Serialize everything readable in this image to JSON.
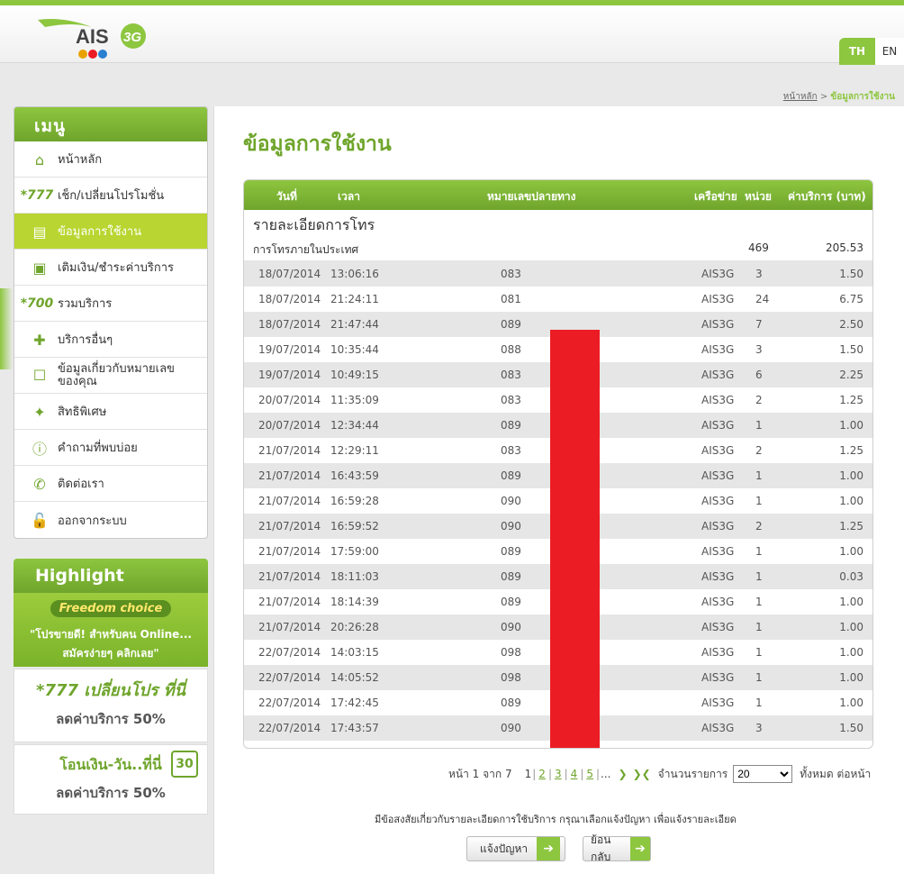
{
  "header": {
    "brand": "AIS",
    "brand_suffix": "3G",
    "lang_th": "TH",
    "lang_en": "EN"
  },
  "breadcrumb": {
    "home": "หน้าหลัก",
    "sep": ">",
    "current": "ข้อมูลการใช้งาน"
  },
  "sidebar": {
    "title": "เมนู",
    "items": [
      {
        "label": "หน้าหลัก",
        "icon": "home-icon",
        "glyph": "⌂"
      },
      {
        "label": "เช็ก/เปลี่ยนโปรโมชั่น",
        "icon": "star777-icon",
        "glyph": "*777"
      },
      {
        "label": "ข้อมูลการใช้งาน",
        "icon": "usage-icon",
        "glyph": "▤"
      },
      {
        "label": "เติมเงิน/ชำระค่าบริการ",
        "icon": "topup-icon",
        "glyph": "▣"
      },
      {
        "label": "รวมบริการ",
        "icon": "star700-icon",
        "glyph": "*700"
      },
      {
        "label": "บริการอื่นๆ",
        "icon": "mobile-plus-icon",
        "glyph": "✚"
      },
      {
        "label": "ข้อมูลเกี่ยวกับหมายเลขของคุณ",
        "icon": "profile-icon",
        "glyph": "☐"
      },
      {
        "label": "สิทธิพิเศษ",
        "icon": "gift-icon",
        "glyph": "✦"
      },
      {
        "label": "คำถามที่พบบ่อย",
        "icon": "info-icon",
        "glyph": "ⓘ"
      },
      {
        "label": "ติดต่อเรา",
        "icon": "phone-icon",
        "glyph": "✆"
      },
      {
        "label": "ออกจากระบบ",
        "icon": "lock-icon",
        "glyph": "🔓"
      }
    ]
  },
  "highlight": {
    "title": "Highlight",
    "banner1": {
      "brand": "Freedom choice",
      "line1": "\"โปรขายดี! สำหรับคน Online...",
      "line2": "สมัครง่ายๆ คลิกเลย\""
    },
    "banner2": {
      "line1": "*777 เปลี่ยนโปร ที่นี่",
      "line2": "ลดค่าบริการ 50%"
    },
    "banner3": {
      "line1": "โอนเงิน-วัน..ที่นี่",
      "line2": "ลดค่าบริการ 50%",
      "badge": "30"
    }
  },
  "main": {
    "title": "ข้อมูลการใช้งาน",
    "columns": {
      "date": "วันที่",
      "time": "เวลา",
      "number": "หมายเลขปลายทาง",
      "network": "เครือข่าย",
      "unit": "หน่วย",
      "charge": "ค่าบริการ (บาท)"
    },
    "section": "รายละเอียดการโทร",
    "subsection": {
      "label": "การโทรภายในประเทศ",
      "units": "469",
      "charge": "205.53"
    },
    "rows": [
      {
        "date": "18/07/2014",
        "time": "13:06:16",
        "number": "083",
        "network": "AIS3G",
        "unit": "3",
        "charge": "1.50"
      },
      {
        "date": "18/07/2014",
        "time": "21:24:11",
        "number": "081",
        "network": "AIS3G",
        "unit": "24",
        "charge": "6.75"
      },
      {
        "date": "18/07/2014",
        "time": "21:47:44",
        "number": "089",
        "network": "AIS3G",
        "unit": "7",
        "charge": "2.50"
      },
      {
        "date": "19/07/2014",
        "time": "10:35:44",
        "number": "088",
        "network": "AIS3G",
        "unit": "3",
        "charge": "1.50"
      },
      {
        "date": "19/07/2014",
        "time": "10:49:15",
        "number": "083",
        "network": "AIS3G",
        "unit": "6",
        "charge": "2.25"
      },
      {
        "date": "20/07/2014",
        "time": "11:35:09",
        "number": "083",
        "network": "AIS3G",
        "unit": "2",
        "charge": "1.25"
      },
      {
        "date": "20/07/2014",
        "time": "12:34:44",
        "number": "089",
        "network": "AIS3G",
        "unit": "1",
        "charge": "1.00"
      },
      {
        "date": "21/07/2014",
        "time": "12:29:11",
        "number": "083",
        "network": "AIS3G",
        "unit": "2",
        "charge": "1.25"
      },
      {
        "date": "21/07/2014",
        "time": "16:43:59",
        "number": "089",
        "network": "AIS3G",
        "unit": "1",
        "charge": "1.00"
      },
      {
        "date": "21/07/2014",
        "time": "16:59:28",
        "number": "090",
        "network": "AIS3G",
        "unit": "1",
        "charge": "1.00"
      },
      {
        "date": "21/07/2014",
        "time": "16:59:52",
        "number": "090",
        "network": "AIS3G",
        "unit": "2",
        "charge": "1.25"
      },
      {
        "date": "21/07/2014",
        "time": "17:59:00",
        "number": "089",
        "network": "AIS3G",
        "unit": "1",
        "charge": "1.00"
      },
      {
        "date": "21/07/2014",
        "time": "18:11:03",
        "number": "089",
        "network": "AIS3G",
        "unit": "1",
        "charge": "0.03"
      },
      {
        "date": "21/07/2014",
        "time": "18:14:39",
        "number": "089",
        "network": "AIS3G",
        "unit": "1",
        "charge": "1.00"
      },
      {
        "date": "21/07/2014",
        "time": "20:26:28",
        "number": "090",
        "network": "AIS3G",
        "unit": "1",
        "charge": "1.00"
      },
      {
        "date": "22/07/2014",
        "time": "14:03:15",
        "number": "098",
        "network": "AIS3G",
        "unit": "1",
        "charge": "1.00"
      },
      {
        "date": "22/07/2014",
        "time": "14:05:52",
        "number": "098",
        "network": "AIS3G",
        "unit": "1",
        "charge": "1.00"
      },
      {
        "date": "22/07/2014",
        "time": "17:42:45",
        "number": "089",
        "network": "AIS3G",
        "unit": "1",
        "charge": "1.00"
      },
      {
        "date": "22/07/2014",
        "time": "17:43:57",
        "number": "090",
        "network": "AIS3G",
        "unit": "3",
        "charge": "1.50"
      }
    ]
  },
  "pager": {
    "page_text": "หน้า 1 จาก 7",
    "current": "1",
    "pages": [
      "2",
      "3",
      "4",
      "5"
    ],
    "ellipsis": "...",
    "next": "❯",
    "last": "❯❮",
    "per_page_label": "จำนวนรายการ",
    "per_page_value": "20",
    "per_page_options": [
      "20"
    ],
    "total_label": "ทั้งหมด ต่อหน้า"
  },
  "footer": {
    "note": "มีข้อสงสัยเกี่ยวกับรายละเอียดการใช้บริการ กรุณาเลือกแจ้งปัญหา เพื่อแจ้งรายละเอียด",
    "report_button": "แจ้งปัญหา",
    "back_button": "ย้อนกลับ",
    "arrow": "➔"
  },
  "colors": {
    "brand_green": "#8dc63f",
    "dark_green": "#6fa52c",
    "active_item": "#b9d531",
    "redaction": "#ec1c24"
  }
}
